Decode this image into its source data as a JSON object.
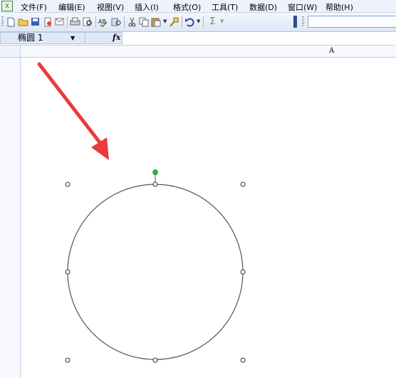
{
  "menu": {
    "items": [
      {
        "label": "文件(F)",
        "name": "menu-file"
      },
      {
        "label": "编辑(E)",
        "name": "menu-edit"
      },
      {
        "label": "视图(V)",
        "name": "menu-view"
      },
      {
        "label": "插入(I)",
        "name": "menu-insert"
      },
      {
        "label": "格式(O)",
        "name": "menu-format"
      },
      {
        "label": "工具(T)",
        "name": "menu-tools"
      },
      {
        "label": "数据(D)",
        "name": "menu-data"
      },
      {
        "label": "窗口(W)",
        "name": "menu-window"
      },
      {
        "label": "帮助(H)",
        "name": "menu-help"
      }
    ]
  },
  "toolbar": {
    "new_icon": "new-document-icon",
    "open_icon": "open-folder-icon",
    "save_icon": "save-icon",
    "permission_icon": "permission-icon",
    "email_icon": "email-icon",
    "print_icon": "print-icon",
    "print_preview_icon": "print-preview-icon",
    "spelling_icon": "spelling-icon",
    "research_icon": "research-icon",
    "cut_icon": "cut-icon",
    "copy_icon": "copy-icon",
    "paste_icon": "paste-icon",
    "format_painter_icon": "format-painter-icon",
    "undo_icon": "undo-icon",
    "autosum_label": "Σ",
    "sigma_color": "#7a7a7a"
  },
  "formula_bar": {
    "name_box_value": "椭圆 1",
    "fx_label": "fx"
  },
  "sheet": {
    "column_header": "A"
  },
  "drawing": {
    "shape": "ellipse",
    "shape_name": "椭圆 1",
    "arrow_color": "#e83b3b",
    "rotation_handle_color": "#22cc22",
    "outline_color": "#555555"
  }
}
